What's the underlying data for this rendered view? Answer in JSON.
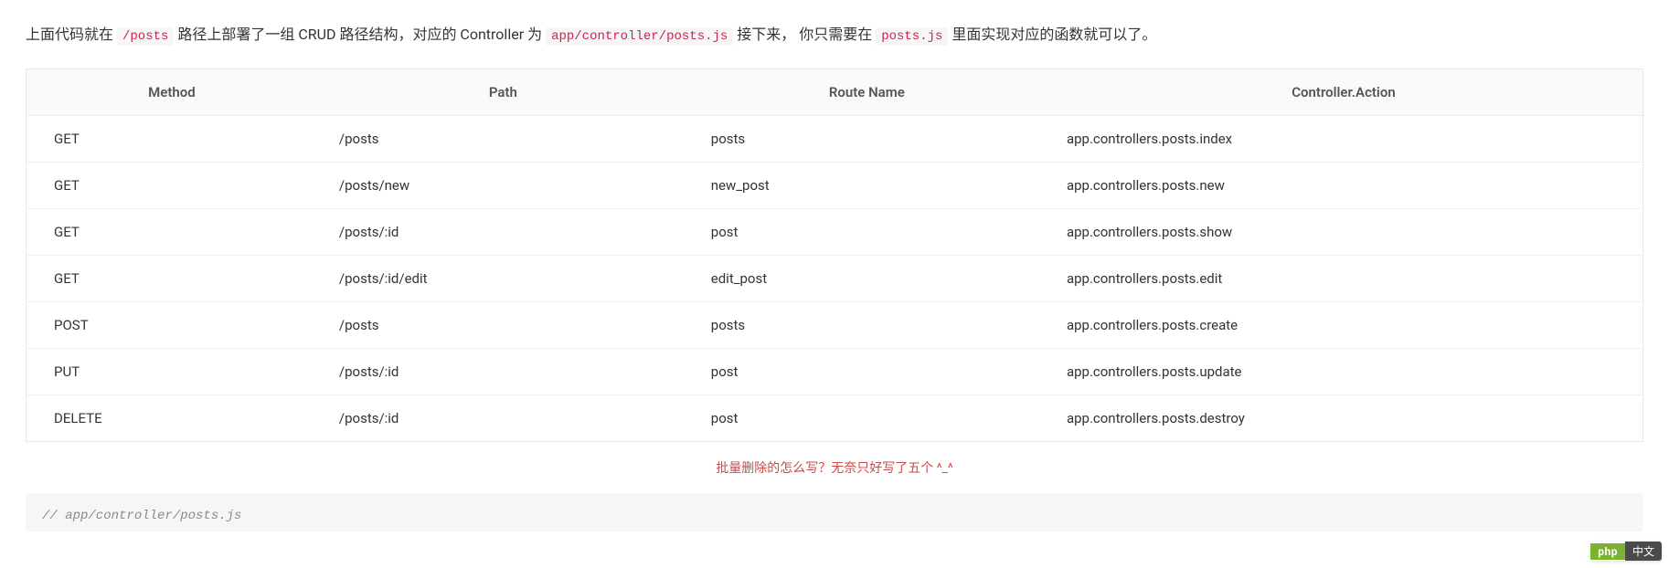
{
  "intro": {
    "part1": "上面代码就在 ",
    "code1": "/posts",
    "part2": " 路径上部署了一组 CRUD 路径结构，对应的 Controller 为 ",
    "code2": "app/controller/posts.js",
    "part3": " 接下来， 你只需要在 ",
    "code3": "posts.js",
    "part4": " 里面实现对应的函数就可以了。"
  },
  "table": {
    "headers": {
      "method": "Method",
      "path": "Path",
      "route_name": "Route Name",
      "controller_action": "Controller.Action"
    },
    "rows": [
      {
        "method": "GET",
        "path": "/posts",
        "route_name": "posts",
        "action": "app.controllers.posts.index"
      },
      {
        "method": "GET",
        "path": "/posts/new",
        "route_name": "new_post",
        "action": "app.controllers.posts.new"
      },
      {
        "method": "GET",
        "path": "/posts/:id",
        "route_name": "post",
        "action": "app.controllers.posts.show"
      },
      {
        "method": "GET",
        "path": "/posts/:id/edit",
        "route_name": "edit_post",
        "action": "app.controllers.posts.edit"
      },
      {
        "method": "POST",
        "path": "/posts",
        "route_name": "posts",
        "action": "app.controllers.posts.create"
      },
      {
        "method": "PUT",
        "path": "/posts/:id",
        "route_name": "post",
        "action": "app.controllers.posts.update"
      },
      {
        "method": "DELETE",
        "path": "/posts/:id",
        "route_name": "post",
        "action": "app.controllers.posts.destroy"
      }
    ]
  },
  "note": "批量删除的怎么写？无奈只好写了五个  ^_^",
  "code_block": {
    "line1": "// app/controller/posts.js"
  },
  "badge": {
    "left": "php",
    "right": "中文"
  }
}
